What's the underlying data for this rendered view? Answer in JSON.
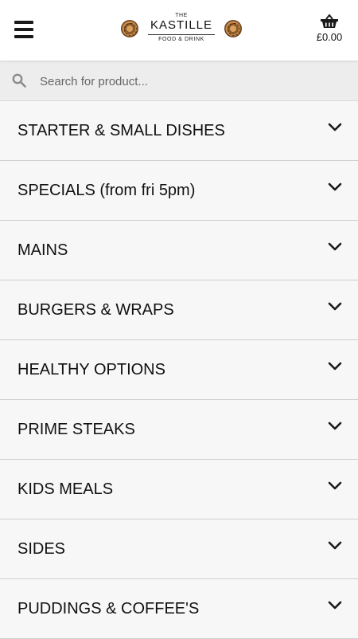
{
  "header": {
    "menu_icon": "hamburger-menu-icon",
    "logo": {
      "the": "THE",
      "brand": "KASTILLE",
      "tagline": "FOOD & DRINK"
    },
    "cart": {
      "icon": "basket-icon",
      "total": "£0.00"
    }
  },
  "search": {
    "icon": "search-icon",
    "placeholder": "Search for product..."
  },
  "categories": [
    {
      "label": "STARTER & SMALL DISHES"
    },
    {
      "label": "SPECIALS (from fri 5pm)"
    },
    {
      "label": "MAINS"
    },
    {
      "label": "BURGERS & WRAPS"
    },
    {
      "label": "HEALTHY OPTIONS"
    },
    {
      "label": "PRIME STEAKS"
    },
    {
      "label": "KIDS MEALS"
    },
    {
      "label": "SIDES"
    },
    {
      "label": "PUDDINGS & COFFEE'S"
    }
  ],
  "colors": {
    "header_bg": "#ffffff",
    "search_bg": "#ededed",
    "list_bg": "#f7f7f7",
    "divider": "#cfcfcf",
    "text": "#111111"
  }
}
